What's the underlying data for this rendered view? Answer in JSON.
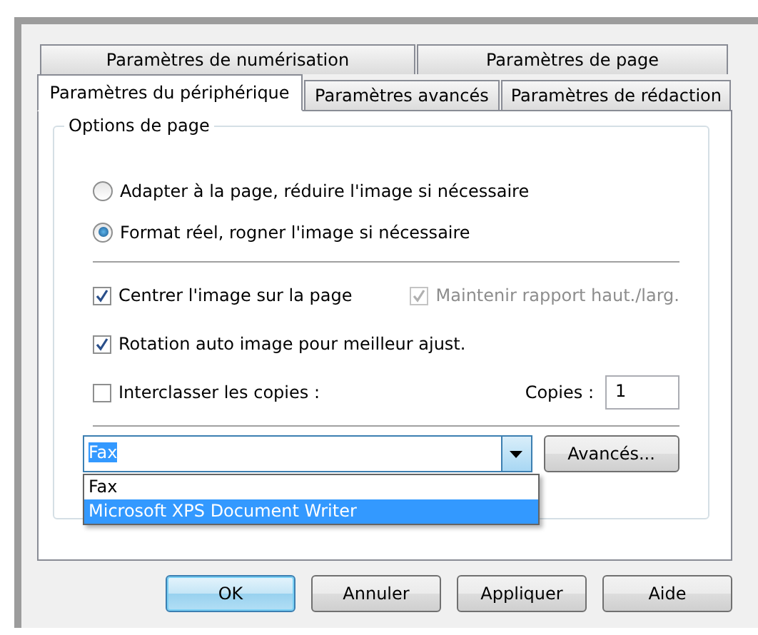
{
  "tabs": [
    {
      "label": "Paramètres de numérisation",
      "kind": "back",
      "selected": false
    },
    {
      "label": "Paramètres de page",
      "kind": "back",
      "selected": false
    },
    {
      "label": "Paramètres du périphérique",
      "kind": "front",
      "selected": true
    },
    {
      "label": "Paramètres avancés",
      "kind": "front",
      "selected": false
    },
    {
      "label": "Paramètres de rédaction",
      "kind": "front",
      "selected": false
    }
  ],
  "group": {
    "title": "Options de page",
    "radios": [
      {
        "label": "Adapter à la page, réduire l'image si nécessaire",
        "selected": false
      },
      {
        "label": "Format réel, rogner l'image si nécessaire",
        "selected": true
      }
    ],
    "checkboxes": [
      {
        "label": "Centrer l'image sur la page",
        "checked": true,
        "disabled": false
      },
      {
        "label": "Maintenir rapport haut./larg.",
        "checked": true,
        "disabled": true
      },
      {
        "label": "Rotation auto image pour meilleur ajust.",
        "checked": true,
        "disabled": false
      },
      {
        "label": "Interclasser les copies :",
        "checked": false,
        "disabled": false
      }
    ],
    "copies": {
      "label": "Copies :",
      "value": "1"
    },
    "printer": {
      "value": "Fax",
      "expanded": true,
      "options": [
        {
          "label": "Fax",
          "highlighted": false
        },
        {
          "label": "Microsoft XPS Document Writer",
          "highlighted": true
        }
      ]
    },
    "advanced_button": "Avancés..."
  },
  "buttons": [
    {
      "label": "OK",
      "default": true
    },
    {
      "label": "Annuler",
      "default": false
    },
    {
      "label": "Appliquer",
      "default": false
    },
    {
      "label": "Aide",
      "default": false
    }
  ]
}
